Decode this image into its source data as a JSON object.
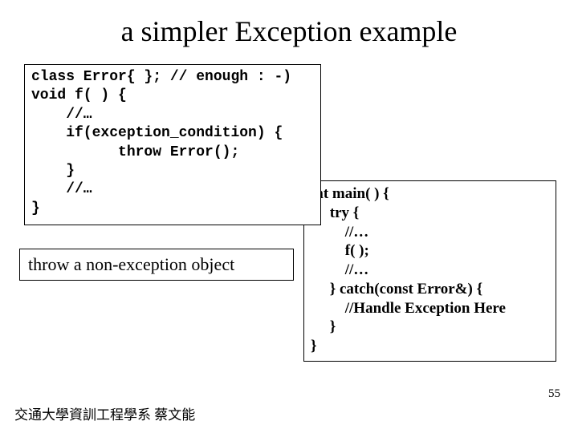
{
  "title": "a simpler Exception example",
  "codebox1": "class Error{ }; // enough : -)\nvoid f( ) {\n    //…\n    if(exception_condition) {\n          throw Error();\n    }\n    //…\n}",
  "codebox2": "int main( ) {\n     try {\n         //…\n         f( );\n         //…\n     } catch(const Error&) {\n         //Handle Exception Here\n     }\n}",
  "label": "throw a non-exception object",
  "page_number": "55",
  "footer": "交通大學資訓工程學系 蔡文能"
}
